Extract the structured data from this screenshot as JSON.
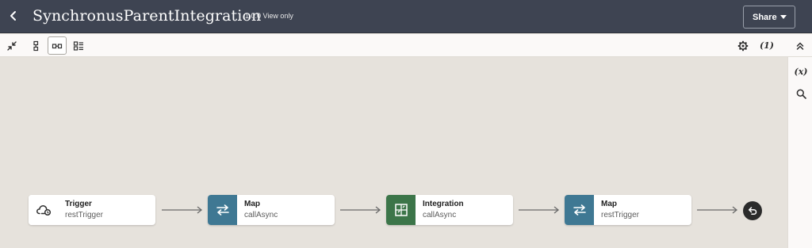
{
  "header": {
    "title": "SynchronusParentIntegration",
    "version": "1.0.0 View only",
    "share_label": "Share"
  },
  "toolbar": {
    "right_label": "(1)"
  },
  "side_panel": {
    "variables_label": "(x)"
  },
  "flow": {
    "nodes": [
      {
        "title": "Trigger",
        "subtitle": "restTrigger",
        "icon": "cloud-trigger-icon",
        "color": "#ffffff"
      },
      {
        "title": "Map",
        "subtitle": "callAsync",
        "icon": "map-arrows-icon",
        "color": "#3f7893"
      },
      {
        "title": "Integration",
        "subtitle": "callAsync",
        "icon": "integration-icon",
        "color": "#3c7549"
      },
      {
        "title": "Map",
        "subtitle": "restTrigger",
        "icon": "map-arrows-icon",
        "color": "#3f7893"
      }
    ]
  }
}
